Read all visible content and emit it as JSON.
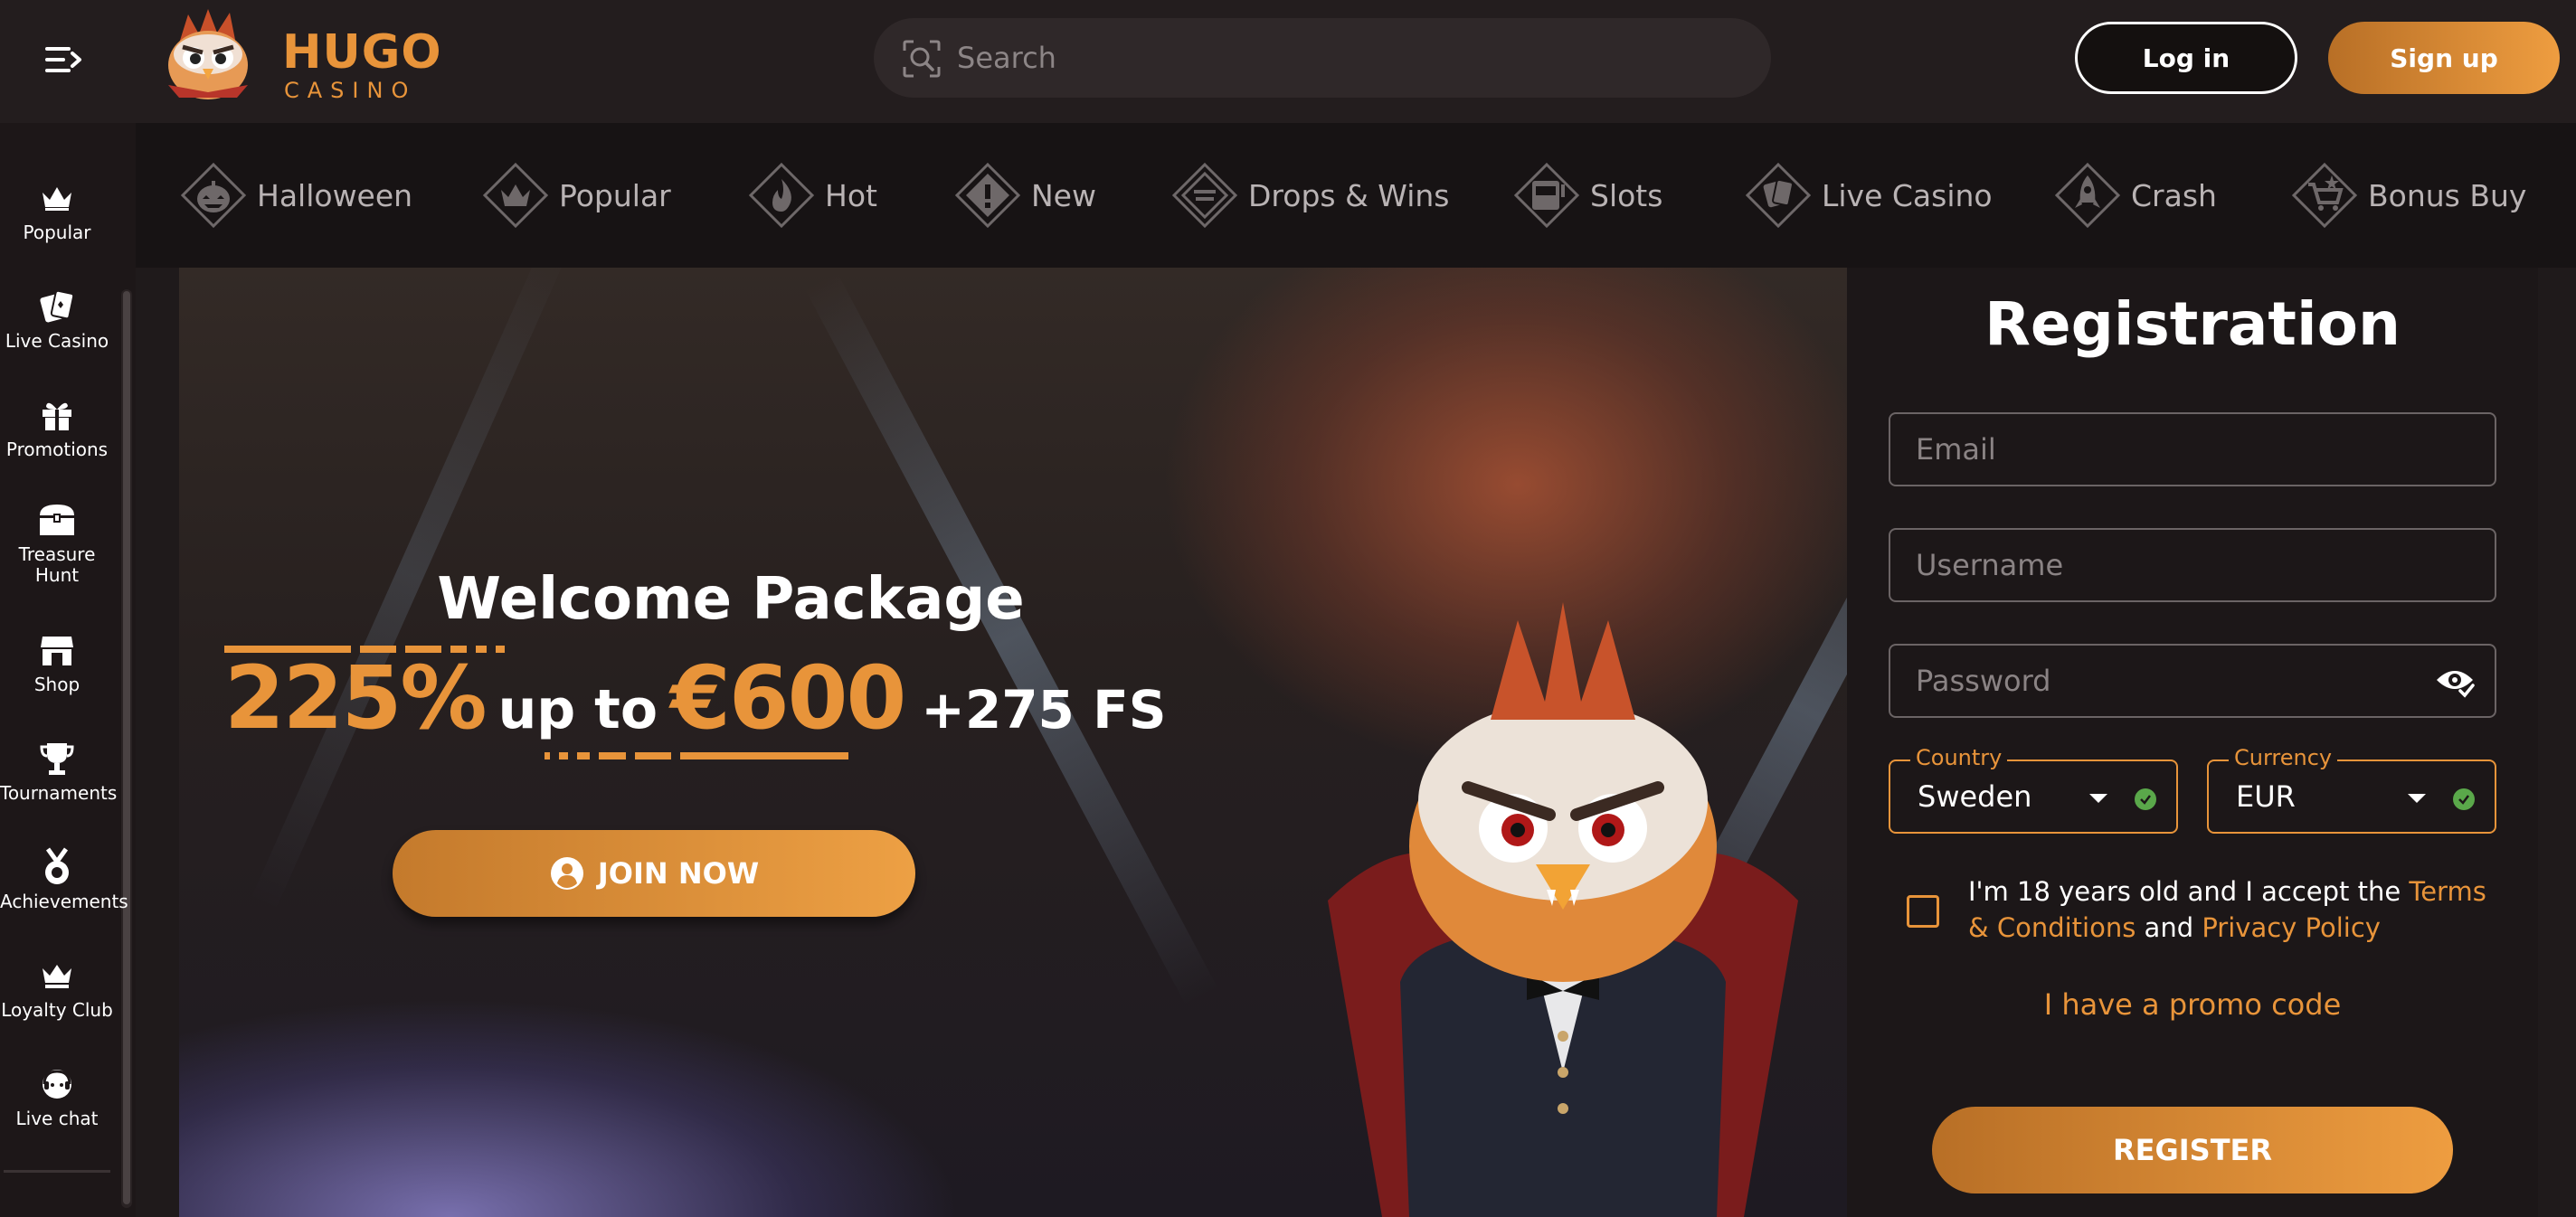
{
  "header": {
    "logo_word": "HUGO",
    "logo_sub": "CASINO",
    "search_placeholder": "Search",
    "login_label": "Log in",
    "signup_label": "Sign up"
  },
  "sidebar": {
    "items": [
      {
        "label": "Popular",
        "icon": "crown-icon"
      },
      {
        "label": "Live Casino",
        "icon": "cards-icon"
      },
      {
        "label": "Promotions",
        "icon": "gift-icon"
      },
      {
        "label": "Treasure Hunt",
        "icon": "treasure-chest-icon"
      },
      {
        "label": "Shop",
        "icon": "shop-icon"
      },
      {
        "label": "Tournaments",
        "icon": "trophy-icon"
      },
      {
        "label": "Achievements",
        "icon": "medal-icon"
      },
      {
        "label": "Loyalty Club",
        "icon": "crown-icon"
      },
      {
        "label": "Live chat",
        "icon": "chat-icon"
      }
    ]
  },
  "categories": [
    {
      "label": "Halloween",
      "icon": "pumpkin-icon"
    },
    {
      "label": "Popular",
      "icon": "crown-icon"
    },
    {
      "label": "Hot",
      "icon": "flame-icon"
    },
    {
      "label": "New",
      "icon": "exclamation-icon"
    },
    {
      "label": "Drops & Wins",
      "icon": "drops-wins-icon"
    },
    {
      "label": "Slots",
      "icon": "slot-machine-icon"
    },
    {
      "label": "Live Casino",
      "icon": "cards-icon"
    },
    {
      "label": "Crash",
      "icon": "rocket-icon"
    },
    {
      "label": "Bonus Buy",
      "icon": "cart-icon"
    }
  ],
  "hero": {
    "title": "Welcome Package",
    "percent": "225%",
    "up_to": "up to",
    "amount": "€600",
    "free_spins": "+275 FS",
    "join_label": "JOIN NOW"
  },
  "registration": {
    "title": "Registration",
    "email_placeholder": "Email",
    "username_placeholder": "Username",
    "password_placeholder": "Password",
    "country_label": "Country",
    "country_value": "Sweden",
    "currency_label": "Currency",
    "currency_value": "EUR",
    "terms_text_1": "I'm 18 years old and I accept the ",
    "terms_link": "Terms & Conditions",
    "terms_and": " and ",
    "privacy_link": "Privacy Policy",
    "promo_label": "I have a promo code",
    "register_label": "REGISTER"
  },
  "colors": {
    "accent": "#e8943a",
    "background": "#1f1a1b",
    "success": "#5aa84a"
  }
}
